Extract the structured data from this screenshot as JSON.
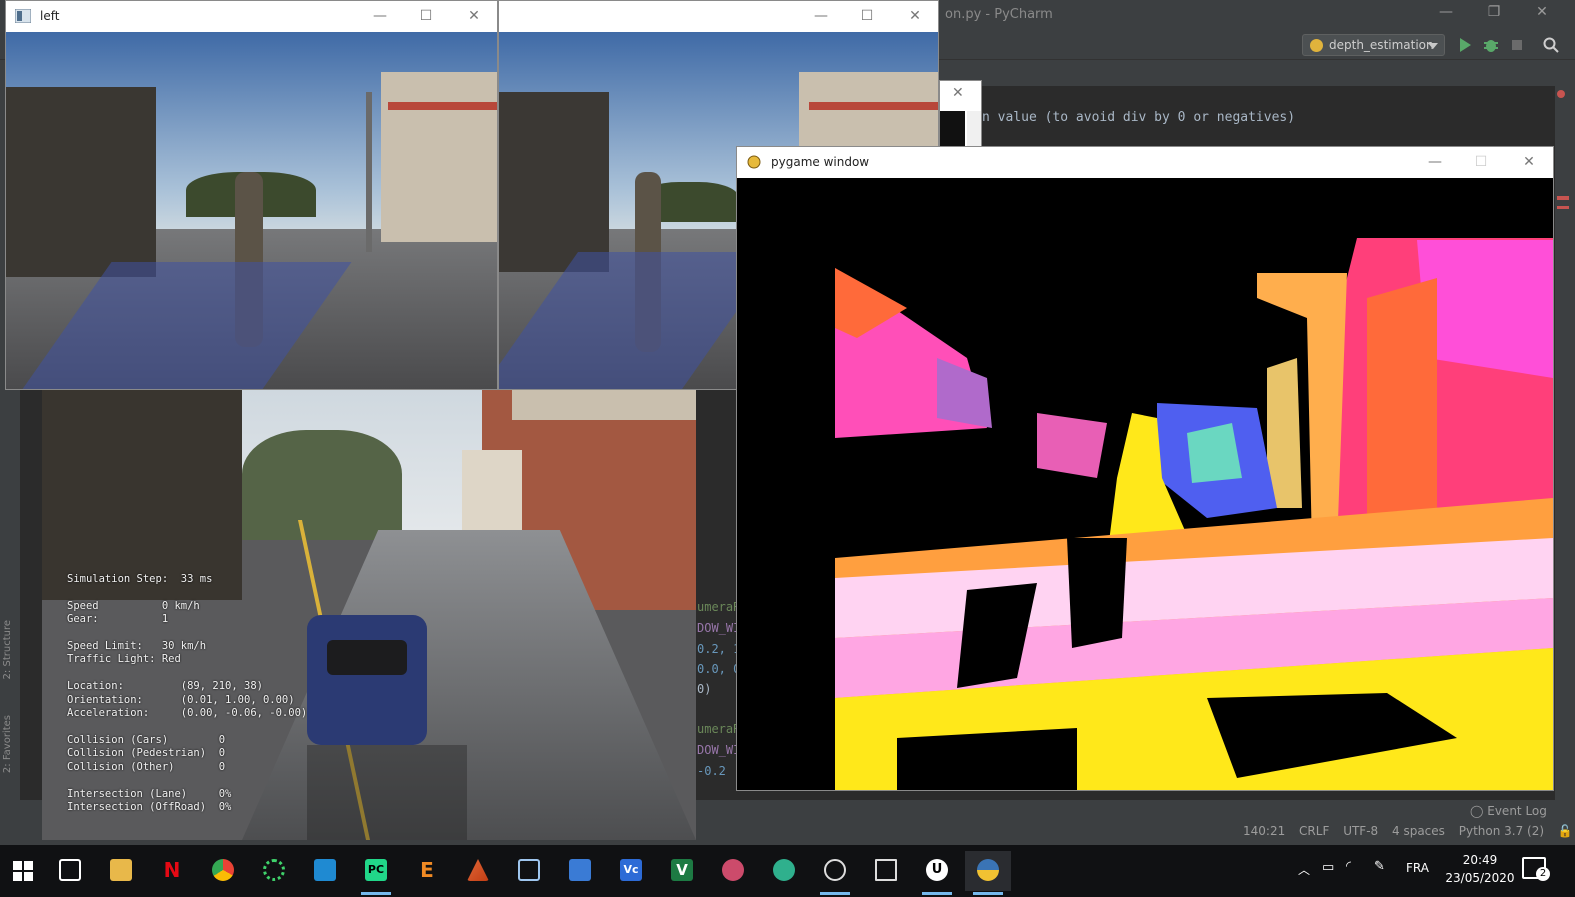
{
  "ide": {
    "title": "on.py - PyCharm",
    "run_config": "depth_estimation",
    "code_comment": "n value (to avoid div by 0 or negatives)",
    "code_fragments": [
      "umeraR",
      "DOW_WI",
      "0.2, 1",
      "0.0, 0",
      "0)",
      "umeraR",
      "DOW_WI",
      "-0.2"
    ],
    "side_tabs": [
      "2: Structure",
      "2: Favorites"
    ],
    "event_log": "Event Log",
    "status": {
      "position": "140:21",
      "line_sep": "CRLF",
      "encoding": "UTF-8",
      "indent": "4 spaces",
      "interpreter": "Python 3.7 (2)"
    }
  },
  "windows": {
    "left": {
      "title": "left"
    },
    "right": {
      "title": ""
    },
    "pygame": {
      "title": "pygame window"
    }
  },
  "hud": {
    "lines": [
      "Simulation Step:  33 ms",
      "",
      "Speed          0 km/h",
      "Gear:          1",
      "",
      "Speed Limit:   30 km/h",
      "Traffic Light: Red",
      "",
      "Location:         (89, 210, 38)",
      "Orientation:      (0.01, 1.00, 0.00)",
      "Acceleration:     (0.00, -0.06, -0.00)",
      "",
      "Collision (Cars)        0",
      "Collision (Pedestrian)  0",
      "Collision (Other)       0",
      "",
      "Intersection (Lane)     0%",
      "Intersection (OffRoad)  0%"
    ]
  },
  "taskbar": {
    "apps": [
      "start-icon",
      "task-view-icon",
      "file-explorer-icon",
      "netflix-icon",
      "chrome-icon",
      "sync-icon",
      "vscode-icon",
      "pycharm-icon",
      "epic-icon",
      "matlab-icon",
      "virtualbox-icon",
      "network-icon",
      "vc-icon",
      "excel-icon",
      "paint-icon",
      "maps-icon",
      "obs-icon",
      "terminal-icon",
      "unreal-icon",
      "python-icon"
    ],
    "language": "FRA",
    "time": "20:49",
    "date": "23/05/2020",
    "notifications": "2"
  }
}
